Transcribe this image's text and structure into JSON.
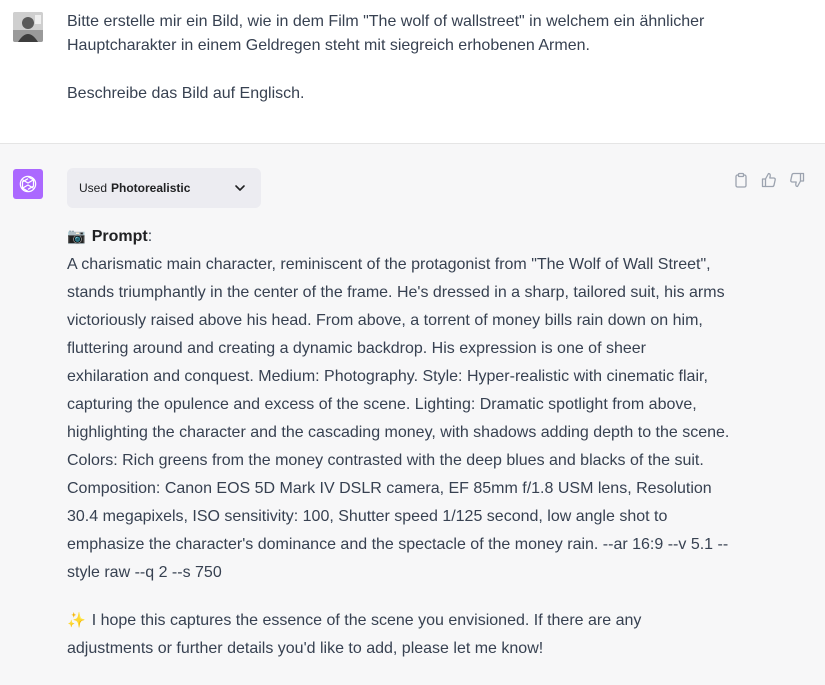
{
  "user": {
    "line1": "Bitte erstelle mir ein Bild, wie in dem Film \"The wolf of wallstreet\" in welchem ein ähnlicher Hauptcharakter in einem Geldregen steht mit siegreich erhobenen Armen.",
    "line2": "Beschreibe das Bild auf Englisch."
  },
  "plugin": {
    "used_label": "Used",
    "name": "Photorealistic"
  },
  "assistant": {
    "prompt_label": "Prompt",
    "prompt_colon": ":",
    "prompt_text": "A charismatic main character, reminiscent of the protagonist from \"The Wolf of Wall Street\", stands triumphantly in the center of the frame. He's dressed in a sharp, tailored suit, his arms victoriously raised above his head. From above, a torrent of money bills rain down on him, fluttering around and creating a dynamic backdrop. His expression is one of sheer exhilaration and conquest. Medium: Photography. Style: Hyper-realistic with cinematic flair, capturing the opulence and excess of the scene. Lighting: Dramatic spotlight from above, highlighting the character and the cascading money, with shadows adding depth to the scene. Colors: Rich greens from the money contrasted with the deep blues and blacks of the suit. Composition: Canon EOS 5D Mark IV DSLR camera, EF 85mm f/1.8 USM lens, Resolution 30.4 megapixels, ISO sensitivity: 100, Shutter speed 1/125 second, low angle shot to emphasize the character's dominance and the spectacle of the money rain. --ar 16:9 --v 5.1 --style raw --q 2 --s 750",
    "closing": "I hope this captures the essence of the scene you envisioned. If there are any adjustments or further details you'd like to add, please let me know!"
  },
  "icons": {
    "camera": "📷",
    "sparkles": "✨",
    "action_copy": "clipboard-icon",
    "action_like": "thumbs-up-icon",
    "action_dislike": "thumbs-down-icon"
  },
  "colors": {
    "gpt_avatar_bg": "#ab68ff",
    "assistant_bg": "#f7f7f8",
    "user_bg": "#ffffff"
  }
}
